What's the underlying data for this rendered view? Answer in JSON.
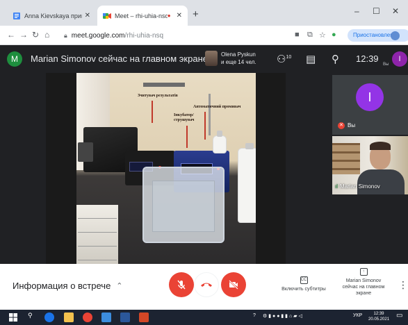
{
  "browser": {
    "tabs": [
      {
        "title": "Anna Kievskaya приглашает ва",
        "active": false
      },
      {
        "title": "Meet – rhi-uhia-nsq",
        "active": true
      }
    ],
    "new_tab_icon": "plus-icon",
    "window_controls": [
      "minimize-icon",
      "maximize-icon",
      "close-icon"
    ],
    "url_host": "meet.google.com",
    "url_path": "/rhi-uhia-nsq",
    "profile_status": "Приостановлена"
  },
  "meet": {
    "presenter_avatar_letter": "M",
    "presenter_title": "Marian Simonov сейчас на главном экране",
    "participants_line1": "Olena Pyskun",
    "participants_line2": "и еще 14 чел.",
    "people_count": "10",
    "time": "12:39",
    "self_avatar_letter": "I",
    "self_sub": "Вы"
  },
  "shared_screen": {
    "annotations": [
      "Зчитувач результатів",
      "Інкубатор/ струшувач",
      "Автоматичний промивач"
    ]
  },
  "tiles": [
    {
      "name": "Вы",
      "avatar_letter": "I",
      "muted": true
    },
    {
      "name": "Marian Simonov",
      "muted": false
    }
  ],
  "controls": {
    "meeting_info": "Информация о встрече",
    "captions_label": "Включить субтитры",
    "presenting_label": "Marian Simonov сейчас на главном экране"
  },
  "taskbar": {
    "language": "УКР",
    "time": "12:39",
    "date": "20.05.2021"
  },
  "colors": {
    "meet_dark": "#202124",
    "danger_red": "#ea4335",
    "accent_purple": "#9334e6",
    "meet_green": "#1e8e3e"
  }
}
